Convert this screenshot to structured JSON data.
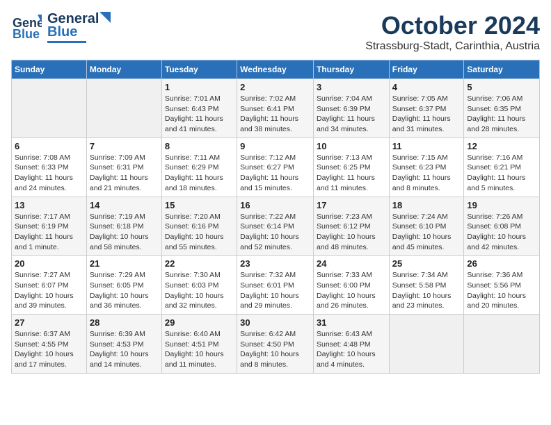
{
  "header": {
    "logo_general": "General",
    "logo_blue": "Blue",
    "month": "October 2024",
    "location": "Strassburg-Stadt, Carinthia, Austria"
  },
  "columns": [
    "Sunday",
    "Monday",
    "Tuesday",
    "Wednesday",
    "Thursday",
    "Friday",
    "Saturday"
  ],
  "weeks": [
    [
      {
        "day": "",
        "sunrise": "",
        "sunset": "",
        "daylight": ""
      },
      {
        "day": "",
        "sunrise": "",
        "sunset": "",
        "daylight": ""
      },
      {
        "day": "1",
        "sunrise": "Sunrise: 7:01 AM",
        "sunset": "Sunset: 6:43 PM",
        "daylight": "Daylight: 11 hours and 41 minutes."
      },
      {
        "day": "2",
        "sunrise": "Sunrise: 7:02 AM",
        "sunset": "Sunset: 6:41 PM",
        "daylight": "Daylight: 11 hours and 38 minutes."
      },
      {
        "day": "3",
        "sunrise": "Sunrise: 7:04 AM",
        "sunset": "Sunset: 6:39 PM",
        "daylight": "Daylight: 11 hours and 34 minutes."
      },
      {
        "day": "4",
        "sunrise": "Sunrise: 7:05 AM",
        "sunset": "Sunset: 6:37 PM",
        "daylight": "Daylight: 11 hours and 31 minutes."
      },
      {
        "day": "5",
        "sunrise": "Sunrise: 7:06 AM",
        "sunset": "Sunset: 6:35 PM",
        "daylight": "Daylight: 11 hours and 28 minutes."
      }
    ],
    [
      {
        "day": "6",
        "sunrise": "Sunrise: 7:08 AM",
        "sunset": "Sunset: 6:33 PM",
        "daylight": "Daylight: 11 hours and 24 minutes."
      },
      {
        "day": "7",
        "sunrise": "Sunrise: 7:09 AM",
        "sunset": "Sunset: 6:31 PM",
        "daylight": "Daylight: 11 hours and 21 minutes."
      },
      {
        "day": "8",
        "sunrise": "Sunrise: 7:11 AM",
        "sunset": "Sunset: 6:29 PM",
        "daylight": "Daylight: 11 hours and 18 minutes."
      },
      {
        "day": "9",
        "sunrise": "Sunrise: 7:12 AM",
        "sunset": "Sunset: 6:27 PM",
        "daylight": "Daylight: 11 hours and 15 minutes."
      },
      {
        "day": "10",
        "sunrise": "Sunrise: 7:13 AM",
        "sunset": "Sunset: 6:25 PM",
        "daylight": "Daylight: 11 hours and 11 minutes."
      },
      {
        "day": "11",
        "sunrise": "Sunrise: 7:15 AM",
        "sunset": "Sunset: 6:23 PM",
        "daylight": "Daylight: 11 hours and 8 minutes."
      },
      {
        "day": "12",
        "sunrise": "Sunrise: 7:16 AM",
        "sunset": "Sunset: 6:21 PM",
        "daylight": "Daylight: 11 hours and 5 minutes."
      }
    ],
    [
      {
        "day": "13",
        "sunrise": "Sunrise: 7:17 AM",
        "sunset": "Sunset: 6:19 PM",
        "daylight": "Daylight: 11 hours and 1 minute."
      },
      {
        "day": "14",
        "sunrise": "Sunrise: 7:19 AM",
        "sunset": "Sunset: 6:18 PM",
        "daylight": "Daylight: 10 hours and 58 minutes."
      },
      {
        "day": "15",
        "sunrise": "Sunrise: 7:20 AM",
        "sunset": "Sunset: 6:16 PM",
        "daylight": "Daylight: 10 hours and 55 minutes."
      },
      {
        "day": "16",
        "sunrise": "Sunrise: 7:22 AM",
        "sunset": "Sunset: 6:14 PM",
        "daylight": "Daylight: 10 hours and 52 minutes."
      },
      {
        "day": "17",
        "sunrise": "Sunrise: 7:23 AM",
        "sunset": "Sunset: 6:12 PM",
        "daylight": "Daylight: 10 hours and 48 minutes."
      },
      {
        "day": "18",
        "sunrise": "Sunrise: 7:24 AM",
        "sunset": "Sunset: 6:10 PM",
        "daylight": "Daylight: 10 hours and 45 minutes."
      },
      {
        "day": "19",
        "sunrise": "Sunrise: 7:26 AM",
        "sunset": "Sunset: 6:08 PM",
        "daylight": "Daylight: 10 hours and 42 minutes."
      }
    ],
    [
      {
        "day": "20",
        "sunrise": "Sunrise: 7:27 AM",
        "sunset": "Sunset: 6:07 PM",
        "daylight": "Daylight: 10 hours and 39 minutes."
      },
      {
        "day": "21",
        "sunrise": "Sunrise: 7:29 AM",
        "sunset": "Sunset: 6:05 PM",
        "daylight": "Daylight: 10 hours and 36 minutes."
      },
      {
        "day": "22",
        "sunrise": "Sunrise: 7:30 AM",
        "sunset": "Sunset: 6:03 PM",
        "daylight": "Daylight: 10 hours and 32 minutes."
      },
      {
        "day": "23",
        "sunrise": "Sunrise: 7:32 AM",
        "sunset": "Sunset: 6:01 PM",
        "daylight": "Daylight: 10 hours and 29 minutes."
      },
      {
        "day": "24",
        "sunrise": "Sunrise: 7:33 AM",
        "sunset": "Sunset: 6:00 PM",
        "daylight": "Daylight: 10 hours and 26 minutes."
      },
      {
        "day": "25",
        "sunrise": "Sunrise: 7:34 AM",
        "sunset": "Sunset: 5:58 PM",
        "daylight": "Daylight: 10 hours and 23 minutes."
      },
      {
        "day": "26",
        "sunrise": "Sunrise: 7:36 AM",
        "sunset": "Sunset: 5:56 PM",
        "daylight": "Daylight: 10 hours and 20 minutes."
      }
    ],
    [
      {
        "day": "27",
        "sunrise": "Sunrise: 6:37 AM",
        "sunset": "Sunset: 4:55 PM",
        "daylight": "Daylight: 10 hours and 17 minutes."
      },
      {
        "day": "28",
        "sunrise": "Sunrise: 6:39 AM",
        "sunset": "Sunset: 4:53 PM",
        "daylight": "Daylight: 10 hours and 14 minutes."
      },
      {
        "day": "29",
        "sunrise": "Sunrise: 6:40 AM",
        "sunset": "Sunset: 4:51 PM",
        "daylight": "Daylight: 10 hours and 11 minutes."
      },
      {
        "day": "30",
        "sunrise": "Sunrise: 6:42 AM",
        "sunset": "Sunset: 4:50 PM",
        "daylight": "Daylight: 10 hours and 8 minutes."
      },
      {
        "day": "31",
        "sunrise": "Sunrise: 6:43 AM",
        "sunset": "Sunset: 4:48 PM",
        "daylight": "Daylight: 10 hours and 4 minutes."
      },
      {
        "day": "",
        "sunrise": "",
        "sunset": "",
        "daylight": ""
      },
      {
        "day": "",
        "sunrise": "",
        "sunset": "",
        "daylight": ""
      }
    ]
  ]
}
